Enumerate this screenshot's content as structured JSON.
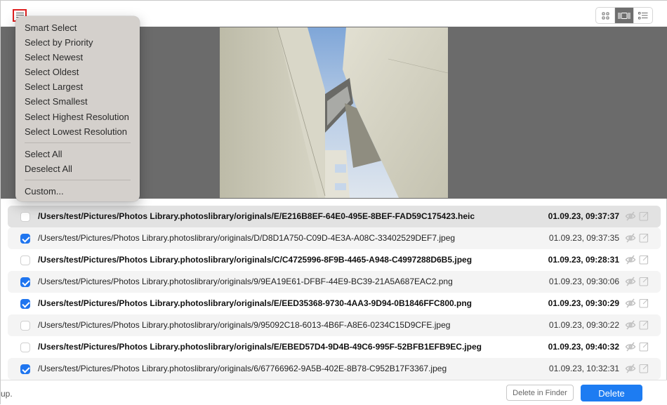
{
  "toolbar": {
    "menu_toggle_icon": "select-menu-icon",
    "view_modes": [
      {
        "name": "grid-view",
        "icon": "grid-icon",
        "active": false
      },
      {
        "name": "filmstrip-view",
        "icon": "filmstrip-icon",
        "active": true
      },
      {
        "name": "list-view",
        "icon": "list-icon",
        "active": false
      }
    ]
  },
  "popup_menu": {
    "groups": [
      [
        "Smart Select",
        "Select by Priority",
        "Select Newest",
        "Select Oldest",
        "Select Largest",
        "Select Smallest",
        "Select Highest Resolution",
        "Select Lowest Resolution"
      ],
      [
        "Select All",
        "Deselect All"
      ],
      [
        "Custom..."
      ]
    ]
  },
  "preview": {
    "description": "Looking up between white angular building walls with walkways against a blue cloudy sky"
  },
  "files": [
    {
      "path": "/Users/test/Pictures/Photos Library.photoslibrary/originals/E/E216B8EF-64E0-495E-8BEF-FAD59C175423.heic",
      "date": "01.09.23, 09:37:37",
      "checked": false,
      "bold": true,
      "highlighted": true
    },
    {
      "path": "/Users/test/Pictures/Photos Library.photoslibrary/originals/D/D8D1A750-C09D-4E3A-A08C-33402529DEF7.jpeg",
      "date": "01.09.23, 09:37:35",
      "checked": true,
      "bold": false
    },
    {
      "path": "/Users/test/Pictures/Photos Library.photoslibrary/originals/C/C4725996-8F9B-4465-A948-C4997288D6B5.jpeg",
      "date": "01.09.23, 09:28:31",
      "checked": false,
      "bold": true
    },
    {
      "path": "/Users/test/Pictures/Photos Library.photoslibrary/originals/9/9EA19E61-DFBF-44E9-BC39-21A5A687EAC2.png",
      "date": "01.09.23, 09:30:06",
      "checked": true,
      "bold": false
    },
    {
      "path": "/Users/test/Pictures/Photos Library.photoslibrary/originals/E/EED35368-9730-4AA3-9D94-0B1846FFC800.png",
      "date": "01.09.23, 09:30:29",
      "checked": true,
      "bold": true
    },
    {
      "path": "/Users/test/Pictures/Photos Library.photoslibrary/originals/9/95092C18-6013-4B6F-A8E6-0234C15D9CFE.jpeg",
      "date": "01.09.23, 09:30:22",
      "checked": false,
      "bold": false
    },
    {
      "path": "/Users/test/Pictures/Photos Library.photoslibrary/originals/E/EBED57D4-9D4B-49C6-995F-52BFB1EFB9EC.jpeg",
      "date": "01.09.23, 09:40:32",
      "checked": false,
      "bold": true
    },
    {
      "path": "/Users/test/Pictures/Photos Library.photoslibrary/originals/6/67766962-9A5B-402E-8B78-C952B17F3367.jpeg",
      "date": "01.09.23, 10:32:31",
      "checked": true,
      "bold": false
    }
  ],
  "row_icons": {
    "hide": "eye-slash-icon",
    "open": "open-external-icon"
  },
  "footer": {
    "status_text": "up.",
    "delete_in_finder_label": "Delete in Finder",
    "delete_label": "Delete"
  },
  "colors": {
    "accent": "#1d7cf2",
    "checkbox_on": "#1f75ef",
    "highlight_annotation": "#e02020",
    "preview_bg": "#6b6b6b",
    "menu_bg": "#d4d0cc"
  }
}
